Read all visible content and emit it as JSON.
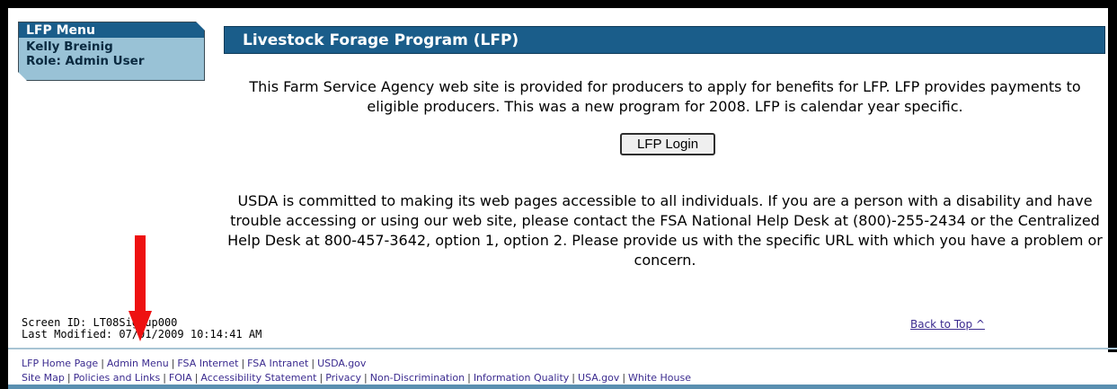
{
  "menu": {
    "title": "LFP Menu",
    "user": "Kelly Breinig",
    "role": "Role: Admin User"
  },
  "header": {
    "title": "Livestock Forage Program (LFP)"
  },
  "content": {
    "intro": "This Farm Service Agency web site is provided for producers to apply for benefits for LFP. LFP provides payments to eligible producers. This was a new program for 2008. LFP is calendar year specific.",
    "login_button": "LFP Login",
    "accessibility": "USDA is committed to making its web pages accessible to all individuals. If you are a person with a disability and have trouble accessing or using our web site, please contact the FSA National Help Desk at (800)-255-2434 or the Centralized Help Desk at 800-457-3642, option 1, option 2. Please provide us with the specific URL with which you have a problem or concern."
  },
  "page_info": {
    "screen_id": "Screen ID: LT08Signup000",
    "last_modified": "Last Modified: 07/01/2009 10:14:41 AM",
    "back_to_top": "Back to Top ^"
  },
  "footer": {
    "row1": [
      "LFP Home Page",
      "Admin Menu",
      "FSA Internet",
      "FSA Intranet",
      "USDA.gov"
    ],
    "row2": [
      "Site Map",
      "Policies and Links",
      "FOIA",
      "Accessibility Statement",
      "Privacy",
      "Non-Discrimination",
      "Information Quality",
      "USA.gov",
      "White House"
    ]
  },
  "colors": {
    "header_blue": "#1a5d8a",
    "menu_light_blue": "#99c2d6",
    "link_purple": "#3b2b8f",
    "arrow_red": "#ee1111"
  }
}
